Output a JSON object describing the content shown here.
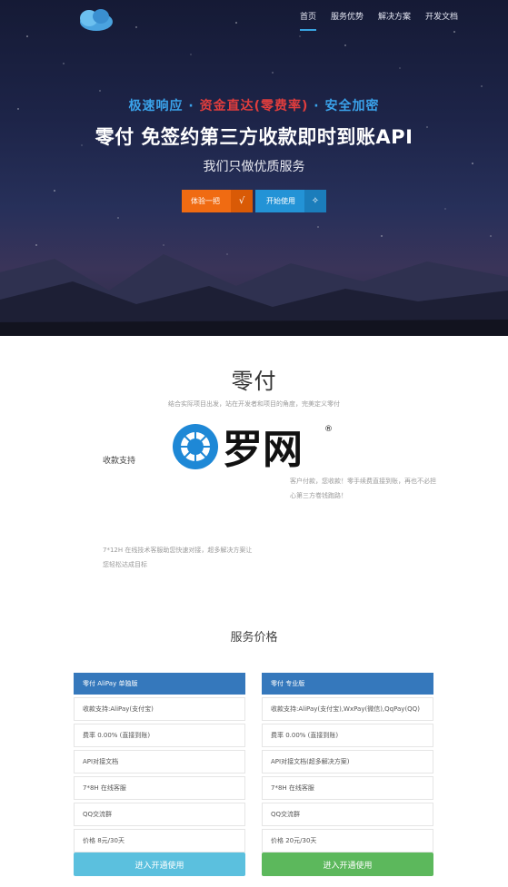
{
  "nav": {
    "items": [
      {
        "label": "首页",
        "active": true
      },
      {
        "label": "服务优势",
        "active": false
      },
      {
        "label": "解决方案",
        "active": false
      },
      {
        "label": "开发文档",
        "active": false
      }
    ]
  },
  "hero": {
    "tagline_a": "极速响应 · ",
    "tagline_b": "资金直达(零费率)",
    "tagline_c": " · 安全加密",
    "title": "零付 免签约第三方收款即时到账API",
    "subtitle": "我们只做优质服务",
    "btn_try": "体验一把",
    "btn_start": "开始使用"
  },
  "about": {
    "title": "零付",
    "desc": "结合实际项目出发，站在开发者和项目的角度，完美定义零付",
    "watermark_text": "罗网",
    "feature_label": "收款支持",
    "feature_right": "客户付款，您收款！零手续费直接到账，再也不必担心第三方卷钱跑路！",
    "feature_left": "7*12H 在线技术客服助您快速对接，超多解决方案让您轻松达成目标"
  },
  "pricing": {
    "title": "服务价格",
    "plans": [
      {
        "name": "零付 AliPay 单独版",
        "rows": [
          "收款支持:AliPay(支付宝)",
          "费率 0.00% (直接到账)",
          "API对接文档",
          "7*8H 在线客服",
          "QQ交流群",
          "价格 8元/30天"
        ],
        "button": "进入开通使用"
      },
      {
        "name": "零付 专业版",
        "rows": [
          "收款支持:AliPay(支付宝),WxPay(微信),QqPay(QQ)",
          "费率 0.00% (直接到账)",
          "API对接文档(超多解决方案)",
          "7*8H 在线客服",
          "QQ交流群",
          "价格 20元/30天"
        ],
        "button": "进入开通使用"
      }
    ]
  },
  "colors": {
    "accent_blue": "#2393d6",
    "accent_orange": "#f06b12",
    "plan_header": "#3578bc",
    "btn_cyan": "#5bc0de",
    "btn_green": "#5cb85c"
  }
}
